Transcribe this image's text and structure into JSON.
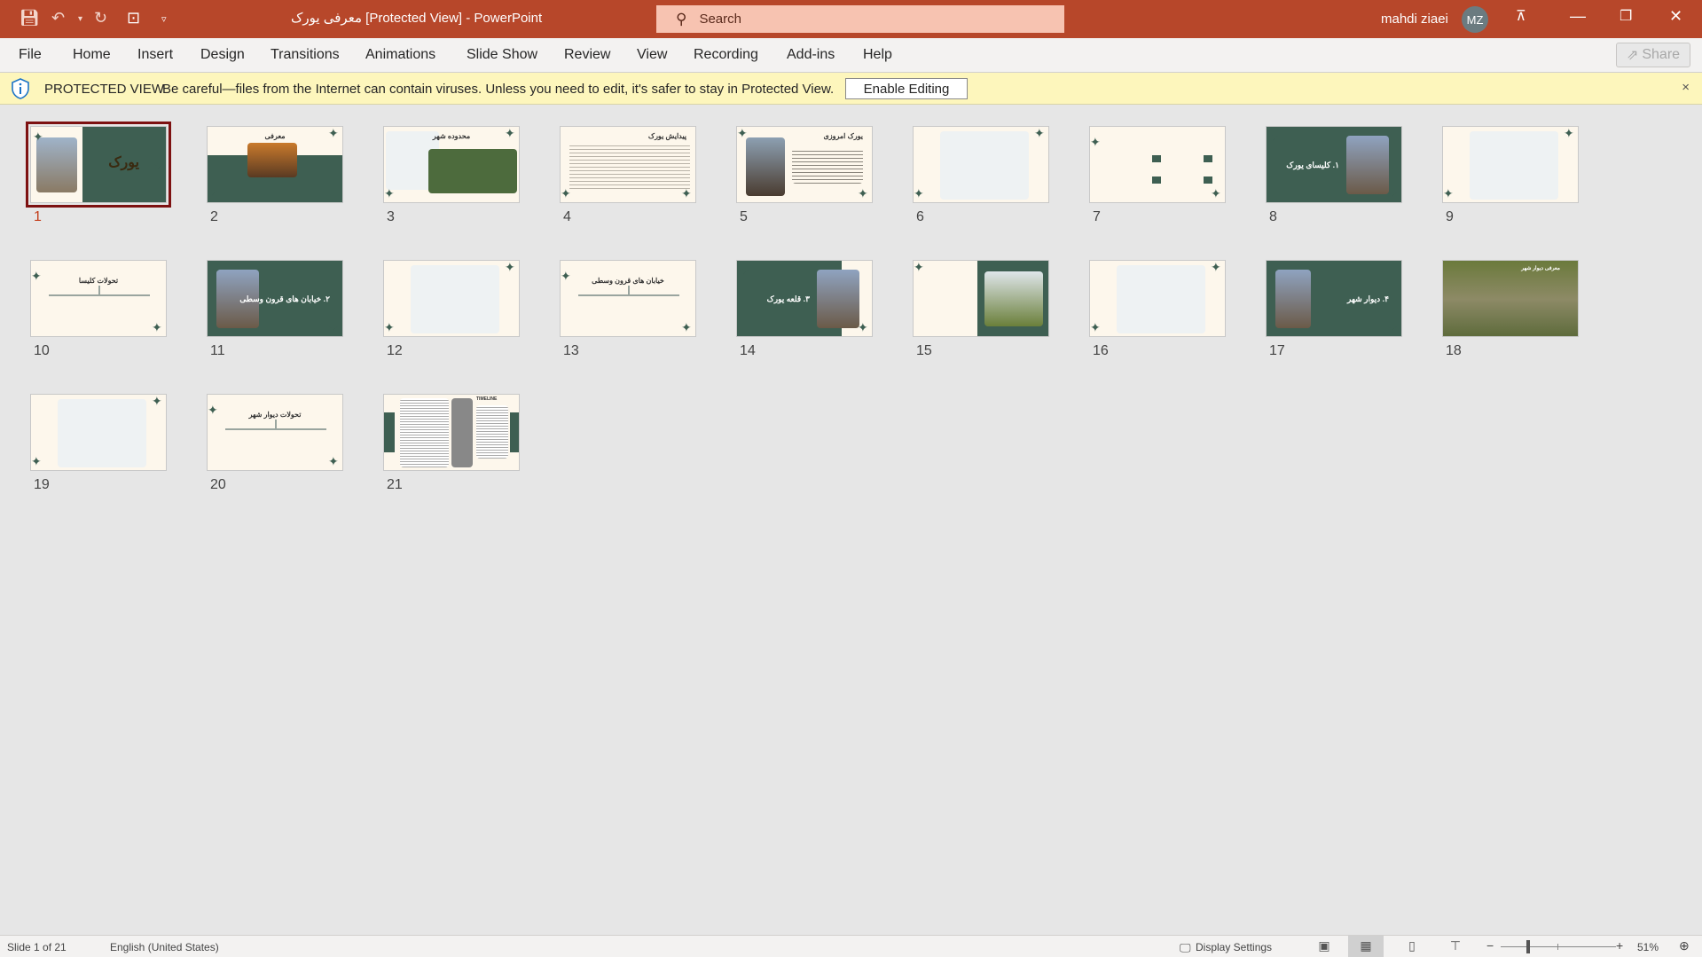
{
  "app": {
    "title": "معرفی یورک [Protected View]  -  PowerPoint",
    "search_placeholder": "Search",
    "user_name": "mahdi ziaei",
    "user_initials": "MZ"
  },
  "menu": [
    "File",
    "Home",
    "Insert",
    "Design",
    "Transitions",
    "Animations",
    "Slide Show",
    "Review",
    "View",
    "Recording",
    "Add-ins",
    "Help"
  ],
  "share_label": "Share",
  "protected_view": {
    "label": "PROTECTED VIEW",
    "message": "Be careful—files from the Internet can contain viruses. Unless you need to edit, it's safer to stay in Protected View.",
    "button": "Enable Editing",
    "close": "×"
  },
  "slides": [
    {
      "n": "1",
      "title": "یورک"
    },
    {
      "n": "2",
      "title": "معرفی"
    },
    {
      "n": "3",
      "title": "محدوده شهر"
    },
    {
      "n": "4",
      "title": "پیدایش یورک"
    },
    {
      "n": "5",
      "title": "یورک امروزی"
    },
    {
      "n": "6",
      "title": ""
    },
    {
      "n": "7",
      "title": ""
    },
    {
      "n": "8",
      "title": "۱. کلیسای یورک"
    },
    {
      "n": "9",
      "title": ""
    },
    {
      "n": "10",
      "title": "تحولات کلیسا"
    },
    {
      "n": "11",
      "title": "۲. خیابان های قرون وسطی"
    },
    {
      "n": "12",
      "title": ""
    },
    {
      "n": "13",
      "title": "خیابان های قرون وسطی"
    },
    {
      "n": "14",
      "title": "۳. قلعه یورک"
    },
    {
      "n": "15",
      "title": ""
    },
    {
      "n": "16",
      "title": ""
    },
    {
      "n": "17",
      "title": "۴. دیوار شهر"
    },
    {
      "n": "18",
      "title": "معرفی دیوار شهر"
    },
    {
      "n": "19",
      "title": ""
    },
    {
      "n": "20",
      "title": "تحولات دیوار شهر"
    },
    {
      "n": "21",
      "title": "TIMELINE"
    }
  ],
  "selected_slide": 1,
  "status": {
    "slide": "Slide 1 of 21",
    "language": "English (United States)",
    "display_settings": "Display Settings",
    "zoom": "51%",
    "zoom_percent": 51
  },
  "colors": {
    "titlebar": "#b7472a",
    "slide_green": "#3e5f52",
    "slide_cream": "#fdf7ec",
    "selection": "#7d1111"
  }
}
